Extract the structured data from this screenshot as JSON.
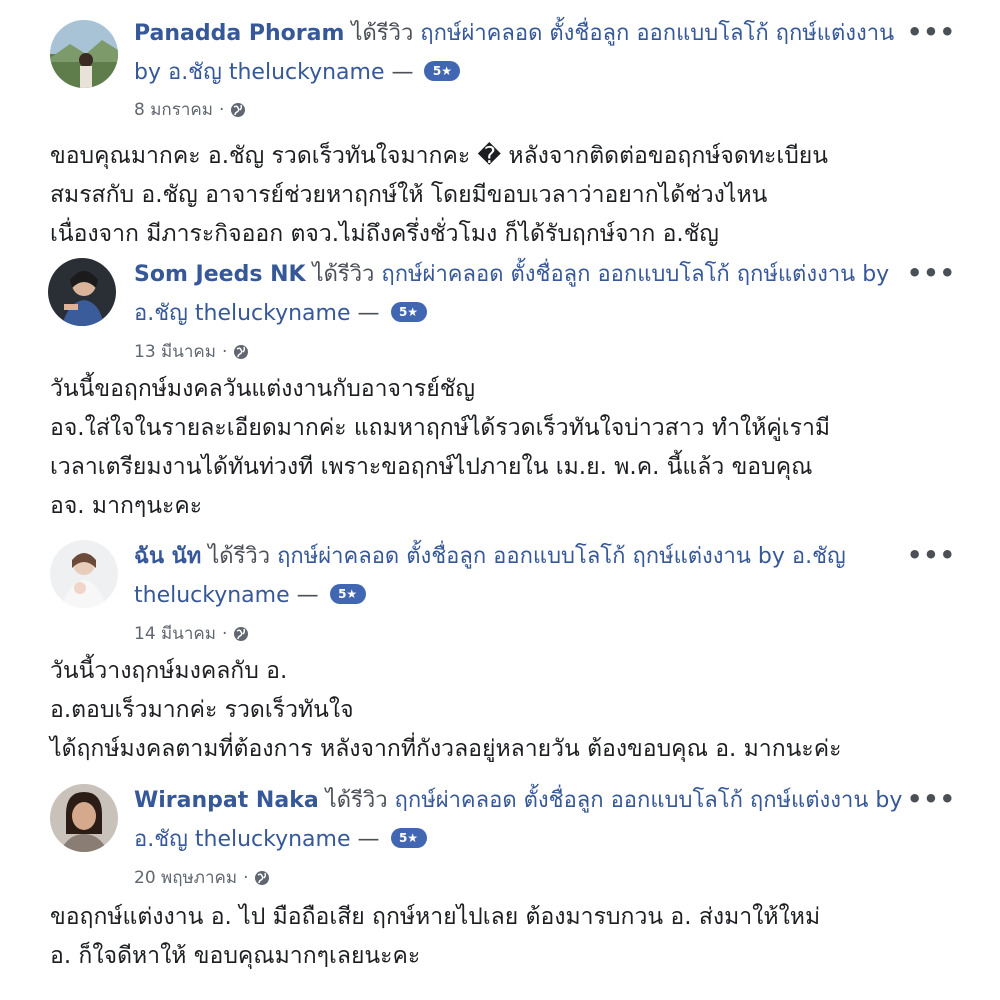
{
  "reviews": [
    {
      "author": "Panadda Phoram",
      "action": "ได้รีวิว",
      "page": "ฤกษ์ผ่าคลอด ตั้งชื่อลูก ออกแบบโลโก้ ฤกษ์แต่งงาน by อ.ชัญ theluckyname",
      "separator": "—",
      "badge": "5★",
      "date": "8 มกราคม",
      "dot": "·",
      "body": [
        "ขอบคุณมากคะ อ.ชัญ รวดเร็วทันใจมากคะ � หลังจากติดต่อขอฤกษ์จดทะเบียน",
        "สมรสกับ อ.ชัญ อาจารย์ช่วยหาฤกษ์ให้ โดยมีขอบเวลาว่าอยากได้ช่วงไหน",
        "เนื่องจาก มีภาระกิจออก ตจว.ไม่ถึงครึ่งชั่วโมง ก็ได้รับฤกษ์จาก อ.ชัญ"
      ],
      "menu": "•••"
    },
    {
      "author": "Som Jeeds NK",
      "action": "ได้รีวิว",
      "page": "ฤกษ์ผ่าคลอด ตั้งชื่อลูก ออกแบบโลโก้ ฤกษ์แต่งงาน by อ.ชัญ theluckyname",
      "separator": "—",
      "badge": "5★",
      "date": "13 มีนาคม",
      "dot": "·",
      "body": [
        "วันนี้ขอฤกษ์มงคลวันแต่งงานกับอาจารย์ชัญ",
        "อจ.ใส่ใจในรายละเอียดมากค่ะ แถมหาฤกษ์ได้รวดเร็วทันใจบ่าวสาว ทำให้คู่เรามี",
        "เวลาเตรียมงานได้ทันท่วงที เพราะขอฤกษ์ไปภายใน เม.ย. พ.ค. นี้แล้ว ขอบคุณ",
        "อจ. มากๆนะคะ"
      ],
      "menu": "•••"
    },
    {
      "author": "ฉัน นัท",
      "action": "ได้รีวิว",
      "page": "ฤกษ์ผ่าคลอด ตั้งชื่อลูก ออกแบบโลโก้ ฤกษ์แต่งงาน by อ.ชัญ theluckyname",
      "separator": "—",
      "badge": "5★",
      "date": "14 มีนาคม",
      "dot": "·",
      "body": [
        "วันนี้วางฤกษ์มงคลกับ อ.",
        "อ.ตอบเร็วมากค่ะ รวดเร็วทันใจ",
        "ได้ฤกษ์มงคลตามที่ต้องการ หลังจากที่กังวลอยู่หลายวัน ต้องขอบคุณ อ. มากนะค่ะ"
      ],
      "menu": "•••"
    },
    {
      "author": "Wiranpat Naka",
      "action": "ได้รีวิว",
      "page": "ฤกษ์ผ่าคลอด ตั้งชื่อลูก ออกแบบโลโก้ ฤกษ์แต่งงาน by อ.ชัญ theluckyname",
      "separator": "—",
      "badge": "5★",
      "date": "20 พฤษภาคม",
      "dot": "·",
      "body": [
        "ขอฤกษ์แต่งงาน อ. ไป มือถือเสีย ฤกษ์หายไปเลย ต้องมารบกวน อ. ส่งมาให้ใหม่",
        "อ. ก็ใจดีหาให้ ขอบคุณมากๆเลยนะคะ"
      ],
      "menu": "•••"
    }
  ],
  "colors": {
    "link": "#365899",
    "badge": "#4267b2",
    "meta": "#616770"
  }
}
